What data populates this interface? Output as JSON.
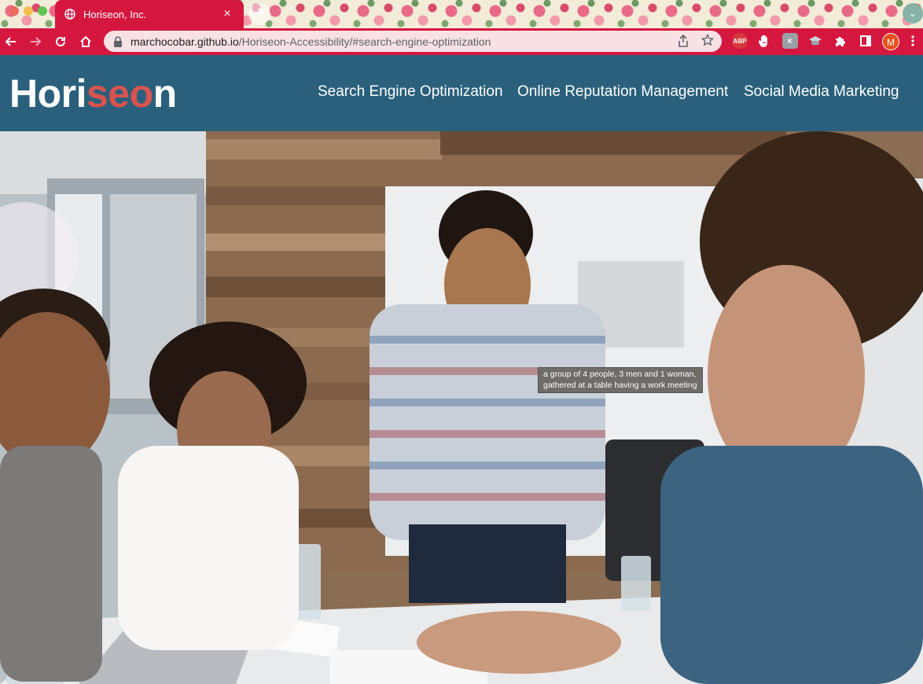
{
  "browser": {
    "tab_title": "Horiseon, Inc.",
    "close_tab": "×",
    "new_tab": "+",
    "url_host": "marchocobar.github.io",
    "url_path": "/Horiseon-Accessibility/#search-engine-optimization",
    "profile_initial": "M",
    "extensions": [
      "ABP",
      "stop-hand-icon",
      "k-extension-icon",
      "mortarboard-icon",
      "puzzle-icon"
    ]
  },
  "header": {
    "logo_part1": "Hori",
    "logo_part2": "seo",
    "logo_part3": "n",
    "nav": [
      "Search Engine Optimization",
      "Online Reputation Management",
      "Social Media Marketing"
    ]
  },
  "hero": {
    "alt_tooltip_line1": "a group of 4 people, 3 men and 1 woman,",
    "alt_tooltip_line2": "gathered at a table having a work meeting"
  },
  "colors": {
    "chrome_accent": "#d5173f",
    "header_bg": "#2a607c",
    "logo_accent": "#d9534f"
  }
}
